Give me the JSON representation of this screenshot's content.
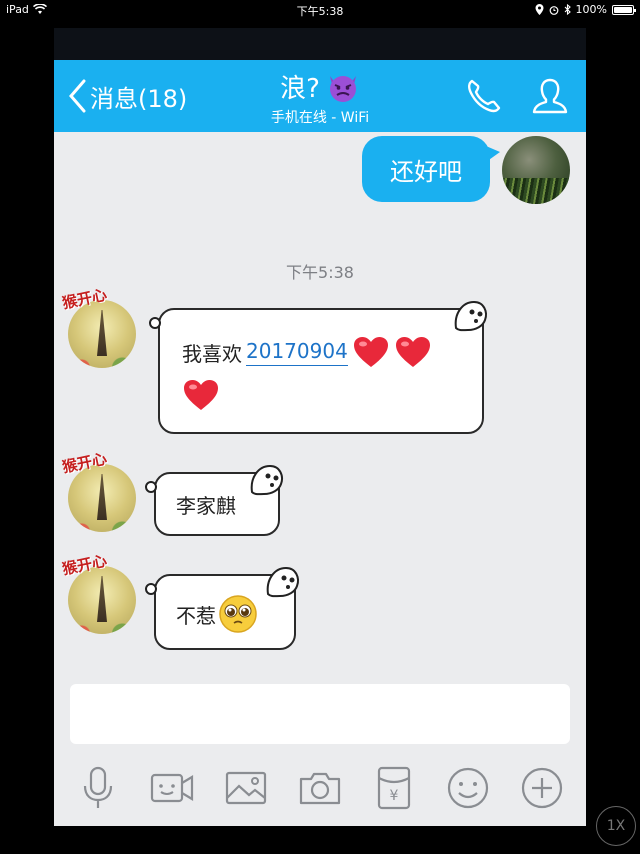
{
  "status_bar": {
    "device": "iPad",
    "time": "下午5:38",
    "battery": "100%"
  },
  "nav": {
    "back_label": "消息(18)",
    "title": "浪?",
    "subtitle": "手机在线 - WiFi",
    "icons": [
      "chevron-left-icon",
      "devil-emoji-icon",
      "phone-icon",
      "profile-icon"
    ]
  },
  "messages": [
    {
      "side": "right",
      "text": "还好吧"
    },
    {
      "side": "left",
      "text_prefix": "我喜欢",
      "link": "20170904",
      "hearts": 3
    },
    {
      "side": "left",
      "text": "李家麒"
    },
    {
      "side": "left",
      "text": "不惹",
      "emoji": "pleading-face-emoji"
    }
  ],
  "timestamp": "下午5:38",
  "sticker_text": "猴开心",
  "toolbar": {
    "icons": [
      "microphone-icon",
      "video-icon",
      "image-icon",
      "camera-icon",
      "red-packet-icon",
      "emoji-icon",
      "plus-icon"
    ],
    "red_packet_symbol": "¥"
  },
  "zoom_label": "1X",
  "colors": {
    "accent": "#1ab0f0",
    "background": "#ebecee",
    "link": "#1d73c8"
  }
}
